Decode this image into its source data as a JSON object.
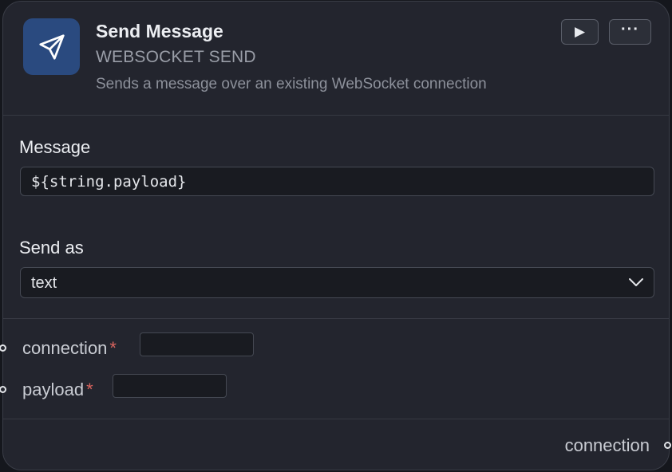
{
  "node": {
    "title": "Send Message",
    "type_label": "WEBSOCKET SEND",
    "description": "Sends a message over an existing WebSocket connection",
    "icon": "send-paper-plane-icon",
    "icon_bg": "#2a4a7f",
    "run_icon": "play-icon",
    "run_glyph": "▶",
    "more_icon": "more-dots-icon",
    "more_glyph": "···"
  },
  "fields": {
    "message": {
      "label": "Message",
      "value": "${string.payload}"
    },
    "send_as": {
      "label": "Send as",
      "value": "text"
    }
  },
  "inputs": [
    {
      "name": "connection",
      "required_mark": "*",
      "value": ""
    },
    {
      "name": "payload",
      "required_mark": "*",
      "value": ""
    }
  ],
  "outputs": [
    {
      "name": "connection"
    }
  ],
  "colors": {
    "node_bg": "#23252e",
    "required": "#d9645e"
  }
}
